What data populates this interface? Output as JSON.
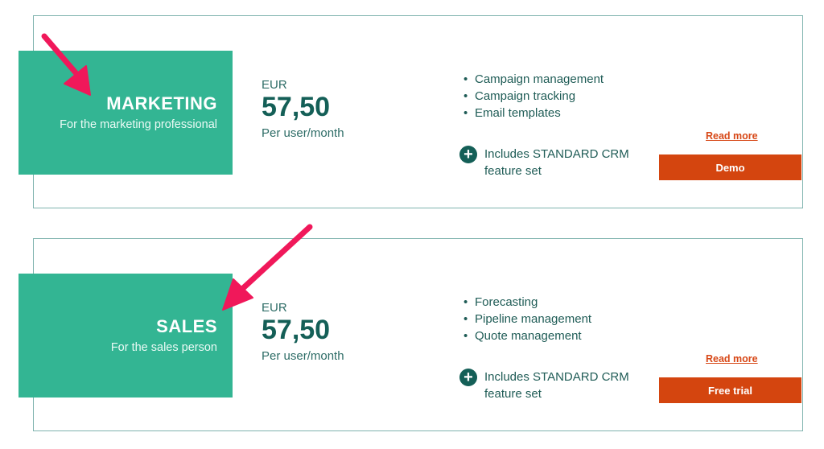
{
  "plans": [
    {
      "name": "MARKETING",
      "tagline": "For the marketing professional",
      "currency": "EUR",
      "price": "57,50",
      "period": "Per user/month",
      "features": [
        "Campaign management",
        "Campaign tracking",
        "Email templates"
      ],
      "includes": "Includes STANDARD CRM feature set",
      "read_more": "Read more",
      "cta": "Demo"
    },
    {
      "name": "SALES",
      "tagline": "For the sales person",
      "currency": "EUR",
      "price": "57,50",
      "period": "Per user/month",
      "features": [
        "Forecasting",
        "Pipeline management",
        "Quote management"
      ],
      "includes": "Includes STANDARD CRM feature set",
      "read_more": "Read more",
      "cta": "Free trial"
    }
  ],
  "icons": {
    "bullet": "•",
    "plus": "+"
  },
  "colors": {
    "tag_green": "#33b593",
    "price_dark": "#145f57",
    "cta_orange": "#d4450f",
    "arrow_pink": "#f0185a",
    "border": "#7fb3ae"
  }
}
